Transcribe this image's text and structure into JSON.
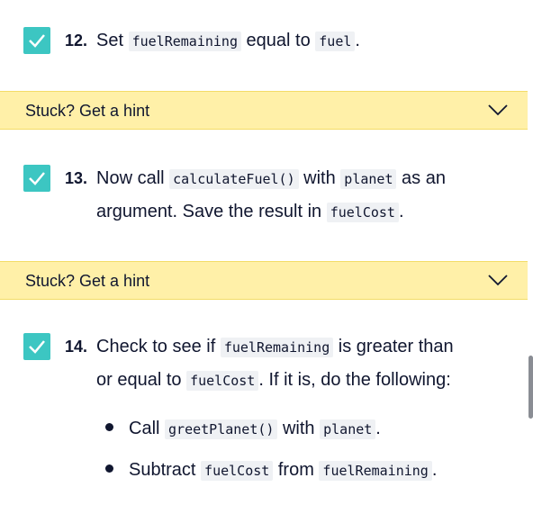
{
  "hint_label": "Stuck? Get a hint",
  "tasks": [
    {
      "number": "12.",
      "parts": [
        "Set ",
        "fuelRemaining",
        " equal to ",
        "fuel",
        "."
      ]
    },
    {
      "number": "13.",
      "line1": [
        "Now call ",
        "calculateFuel()",
        " with ",
        "planet",
        " as an"
      ],
      "line2": [
        "argument. Save the result in ",
        "fuelCost",
        "."
      ]
    },
    {
      "number": "14.",
      "line1": [
        "Check to see if ",
        "fuelRemaining",
        " is greater than"
      ],
      "line2": [
        "or equal to ",
        "fuelCost",
        ". If it is, do the following:"
      ],
      "bullets": [
        [
          "Call ",
          "greetPlanet()",
          " with ",
          "planet",
          "."
        ],
        [
          "Subtract ",
          "fuelCost",
          " from ",
          "fuelRemaining",
          "."
        ]
      ]
    }
  ],
  "colors": {
    "checkbox": "#3cc6c2",
    "hint_bg": "#fff0a8",
    "text": "#10162f"
  },
  "icons": {
    "check": "check-icon",
    "chevron": "chevron-down-icon"
  }
}
